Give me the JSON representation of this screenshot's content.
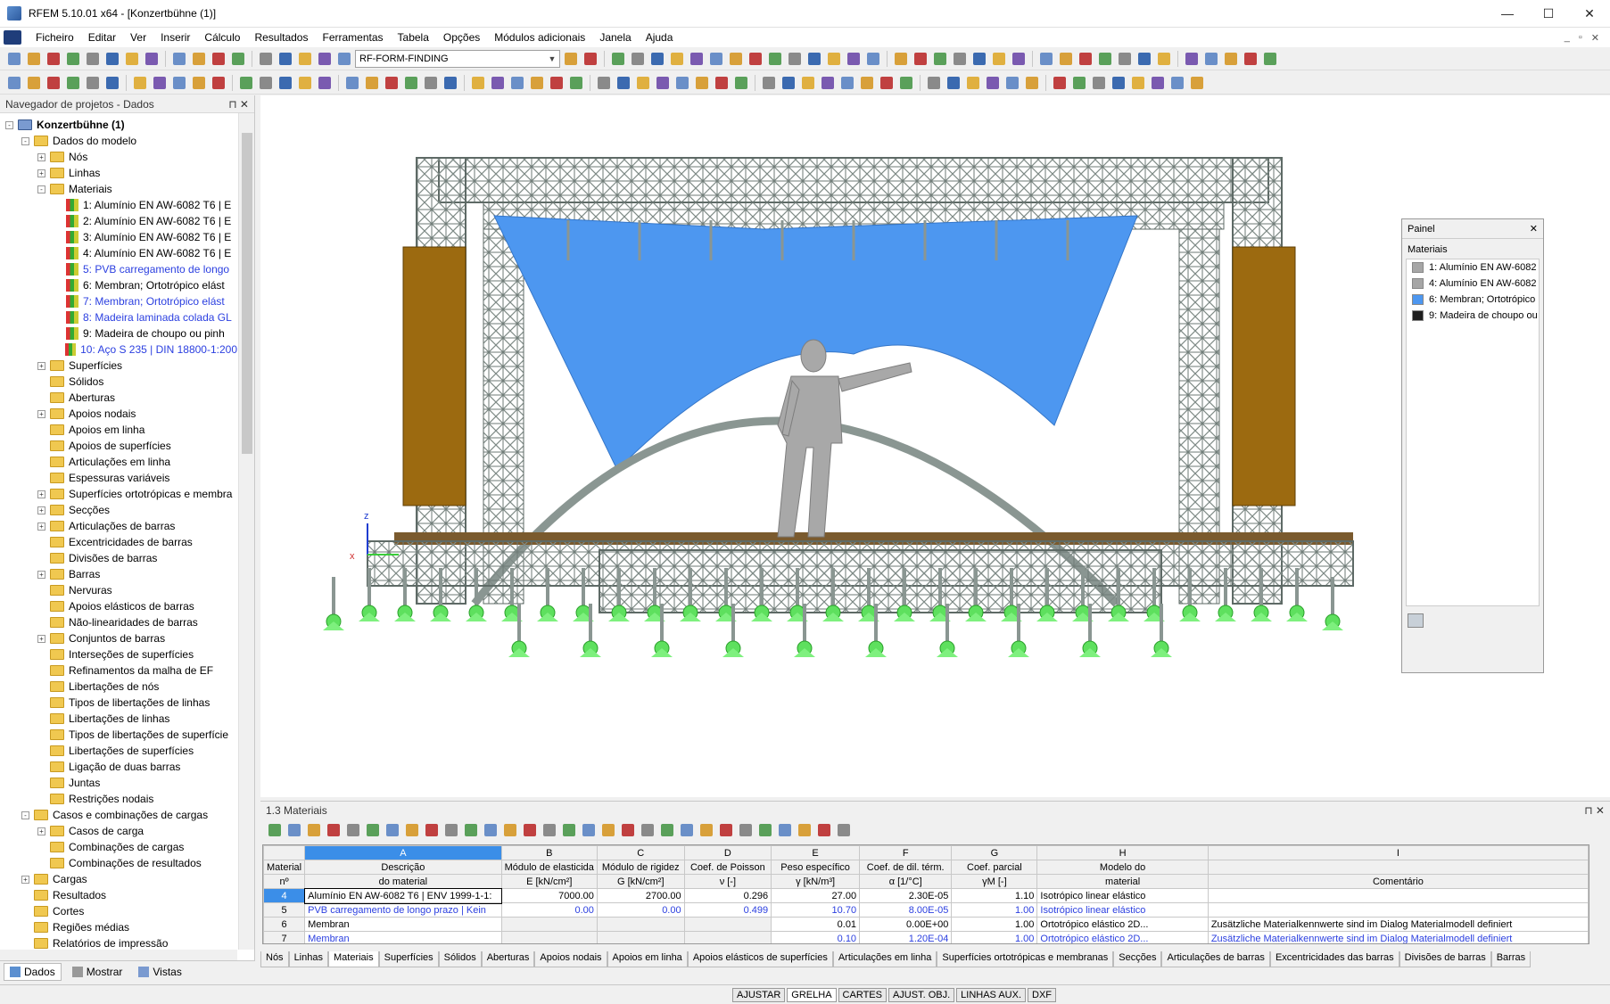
{
  "window": {
    "title": "RFEM 5.10.01 x64 - [Konzertbühne (1)]",
    "min": "—",
    "max": "☐",
    "close": "✕"
  },
  "menu": [
    "Ficheiro",
    "Editar",
    "Ver",
    "Inserir",
    "Cálculo",
    "Resultados",
    "Ferramentas",
    "Tabela",
    "Opções",
    "Módulos adicionais",
    "Janela",
    "Ajuda"
  ],
  "toolbar": {
    "combo": "RF-FORM-FINDING"
  },
  "navigator": {
    "title": "Navegador de projetos - Dados",
    "items": [
      {
        "label": "Konzertbühne (1)",
        "level": 0,
        "exp": "-",
        "bold": true
      },
      {
        "label": "Dados do modelo",
        "level": 1,
        "exp": "-"
      },
      {
        "label": "Nós",
        "level": 2,
        "exp": "+"
      },
      {
        "label": "Linhas",
        "level": 2,
        "exp": "+"
      },
      {
        "label": "Materiais",
        "level": 2,
        "exp": "-"
      },
      {
        "label": "1: Alumínio EN AW-6082 T6 | E",
        "level": 3,
        "mat": true
      },
      {
        "label": "2: Alumínio EN AW-6082 T6 | E",
        "level": 3,
        "mat": true
      },
      {
        "label": "3: Alumínio EN AW-6082 T6 | E",
        "level": 3,
        "mat": true
      },
      {
        "label": "4: Alumínio EN AW-6082 T6 | E",
        "level": 3,
        "mat": true
      },
      {
        "label": "5: PVB carregamento de longo",
        "level": 3,
        "mat": true,
        "blue": true
      },
      {
        "label": "6: Membran; Ortotrópico elást",
        "level": 3,
        "mat": true
      },
      {
        "label": "7: Membran; Ortotrópico elást",
        "level": 3,
        "mat": true,
        "blue": true
      },
      {
        "label": "8: Madeira laminada colada GL",
        "level": 3,
        "mat": true,
        "blue": true
      },
      {
        "label": "9: Madeira de choupo ou pinh",
        "level": 3,
        "mat": true
      },
      {
        "label": "10: Aço S 235 | DIN 18800-1:200",
        "level": 3,
        "mat": true,
        "blue": true
      },
      {
        "label": "Superfícies",
        "level": 2,
        "exp": "+"
      },
      {
        "label": "Sólidos",
        "level": 2
      },
      {
        "label": "Aberturas",
        "level": 2
      },
      {
        "label": "Apoios nodais",
        "level": 2,
        "exp": "+"
      },
      {
        "label": "Apoios em linha",
        "level": 2
      },
      {
        "label": "Apoios de superfícies",
        "level": 2
      },
      {
        "label": "Articulações em linha",
        "level": 2
      },
      {
        "label": "Espessuras variáveis",
        "level": 2
      },
      {
        "label": "Superfícies ortotrópicas e membra",
        "level": 2,
        "exp": "+"
      },
      {
        "label": "Secções",
        "level": 2,
        "exp": "+"
      },
      {
        "label": "Articulações de barras",
        "level": 2,
        "exp": "+"
      },
      {
        "label": "Excentricidades de barras",
        "level": 2
      },
      {
        "label": "Divisões de barras",
        "level": 2
      },
      {
        "label": "Barras",
        "level": 2,
        "exp": "+"
      },
      {
        "label": "Nervuras",
        "level": 2
      },
      {
        "label": "Apoios elásticos de barras",
        "level": 2
      },
      {
        "label": "Não-linearidades de barras",
        "level": 2
      },
      {
        "label": "Conjuntos de barras",
        "level": 2,
        "exp": "+"
      },
      {
        "label": "Interseções de superfícies",
        "level": 2
      },
      {
        "label": "Refinamentos da malha de EF",
        "level": 2
      },
      {
        "label": "Libertações de nós",
        "level": 2
      },
      {
        "label": "Tipos de libertações de linhas",
        "level": 2
      },
      {
        "label": "Libertações de linhas",
        "level": 2
      },
      {
        "label": "Tipos de libertações de superfície",
        "level": 2
      },
      {
        "label": "Libertações de superfícies",
        "level": 2
      },
      {
        "label": "Ligação de duas barras",
        "level": 2
      },
      {
        "label": "Juntas",
        "level": 2
      },
      {
        "label": "Restrições nodais",
        "level": 2
      },
      {
        "label": "Casos e combinações de cargas",
        "level": 1,
        "exp": "-"
      },
      {
        "label": "Casos de carga",
        "level": 2,
        "exp": "+"
      },
      {
        "label": "Combinações de cargas",
        "level": 2
      },
      {
        "label": "Combinações de resultados",
        "level": 2
      },
      {
        "label": "Cargas",
        "level": 1,
        "exp": "+"
      },
      {
        "label": "Resultados",
        "level": 1
      },
      {
        "label": "Cortes",
        "level": 1
      },
      {
        "label": "Regiões médias",
        "level": 1
      },
      {
        "label": "Relatórios de impressão",
        "level": 1
      }
    ],
    "tabs": [
      "Dados",
      "Mostrar",
      "Vistas"
    ]
  },
  "viewport": {
    "axes": {
      "x": "x",
      "z": "z"
    }
  },
  "painel": {
    "title": "Painel",
    "subtitle": "Materiais",
    "items": [
      {
        "label": "1: Alumínio EN AW-6082",
        "color": "#a6a6a6"
      },
      {
        "label": "4: Alumínio EN AW-6082",
        "color": "#a6a6a6"
      },
      {
        "label": "6: Membran; Ortotrópico",
        "color": "#4d97f0"
      },
      {
        "label": "9: Madeira de choupo ou",
        "color": "#1e1e1e"
      }
    ]
  },
  "table": {
    "title": "1.3 Materiais",
    "col_letters": [
      "A",
      "B",
      "C",
      "D",
      "E",
      "F",
      "G",
      "H",
      "I"
    ],
    "headers": [
      [
        "Material",
        "Descrição",
        "Módulo de elasticida",
        "Módulo de rigidez",
        "Coef. de Poisson",
        "Peso específico",
        "Coef. de dil. térm.",
        "Coef. parcial",
        "Modelo do",
        ""
      ],
      [
        "nº",
        "do material",
        "E [kN/cm²]",
        "G [kN/cm²]",
        "ν [-]",
        "γ [kN/m³]",
        "α [1/°C]",
        "γM [-]",
        "material",
        "Comentário"
      ]
    ],
    "rows": [
      {
        "n": "4",
        "desc": "Alumínio EN AW-6082 T6 | ENV 1999-1-1:",
        "E": "7000.00",
        "G": "2700.00",
        "nu": "0.296",
        "gamma": "27.00",
        "alpha": "2.30E-05",
        "gm": "1.10",
        "model": "Isotrópico linear elástico",
        "comment": "",
        "blue": false,
        "sel": true
      },
      {
        "n": "5",
        "desc": "PVB carregamento de longo prazo | Kein",
        "E": "0.00",
        "G": "0.00",
        "nu": "0.499",
        "gamma": "10.70",
        "alpha": "8.00E-05",
        "gm": "1.00",
        "model": "Isotrópico linear elástico",
        "comment": "",
        "blue": true
      },
      {
        "n": "6",
        "desc": "Membran",
        "E": "",
        "G": "",
        "nu": "",
        "gamma": "0.01",
        "alpha": "0.00E+00",
        "gm": "1.00",
        "model": "Ortotrópico elástico 2D...",
        "comment": "Zusätzliche Materialkennwerte sind im Dialog Materialmodell definiert",
        "blue": false
      },
      {
        "n": "7",
        "desc": "Membran",
        "E": "",
        "G": "",
        "nu": "",
        "gamma": "0.10",
        "alpha": "1.20E-04",
        "gm": "1.00",
        "model": "Ortotrópico elástico 2D...",
        "comment": "Zusätzliche Materialkennwerte sind im Dialog Materialmodell definiert",
        "blue": true
      }
    ],
    "tabs": [
      "Nós",
      "Linhas",
      "Materiais",
      "Superfícies",
      "Sólidos",
      "Aberturas",
      "Apoios nodais",
      "Apoios em linha",
      "Apoios elásticos de superfícies",
      "Articulações em linha",
      "Superfícies ortotrópicas e membranas",
      "Secções",
      "Articulações de barras",
      "Excentricidades das barras",
      "Divisões de barras",
      "Barras"
    ]
  },
  "status": [
    "AJUSTAR",
    "GRELHA",
    "CARTES",
    "AJUST. OBJ.",
    "LINHAS AUX.",
    "DXF"
  ]
}
